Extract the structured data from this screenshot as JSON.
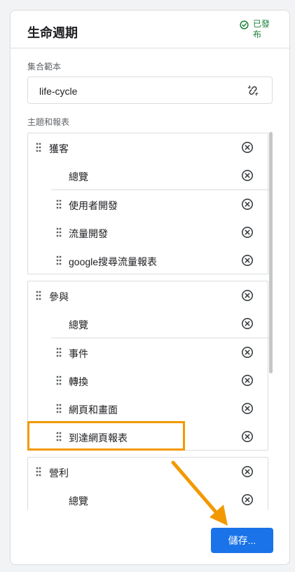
{
  "header": {
    "title": "生命週期",
    "status_text": "已發布"
  },
  "collection": {
    "label": "集合範本",
    "value": "life-cycle"
  },
  "topics": {
    "label": "主題和報表",
    "groups": [
      {
        "name": "獲客",
        "items": [
          "總覽",
          "使用者開發",
          "流量開發",
          "google搜尋流量報表"
        ]
      },
      {
        "name": "參與",
        "items": [
          "總覽",
          "事件",
          "轉換",
          "網頁和畫面",
          "到達網頁報表"
        ]
      },
      {
        "name": "營利",
        "items": [
          "總覽"
        ]
      }
    ]
  },
  "footer": {
    "save_label": "儲存..."
  },
  "colors": {
    "accent": "#1a73e8",
    "published": "#188038",
    "highlight": "#f29900"
  }
}
